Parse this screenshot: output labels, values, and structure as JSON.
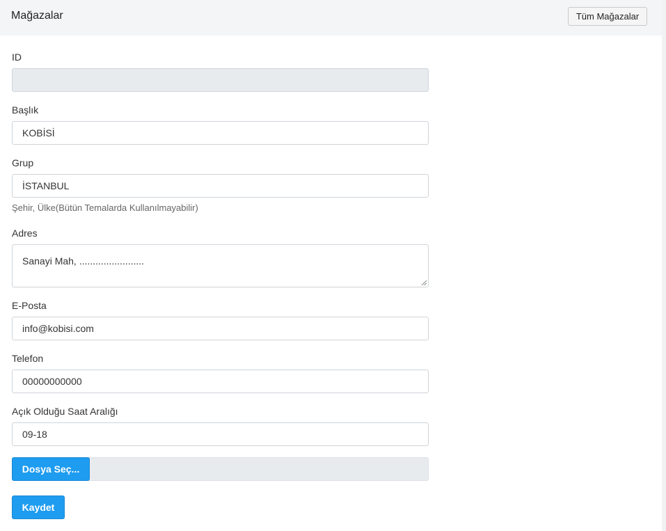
{
  "header": {
    "title": "Mağazalar",
    "all_stores_button": "Tüm Mağazalar"
  },
  "form": {
    "id": {
      "label": "ID",
      "value": ""
    },
    "title": {
      "label": "Başlık",
      "value": "KOBİSİ"
    },
    "group": {
      "label": "Grup",
      "value": "İSTANBUL",
      "help": "Şehir, Ülke(Bütün Temalarda Kullanılmayabilir)"
    },
    "address": {
      "label": "Adres",
      "value": "Sanayi Mah, ........................"
    },
    "email": {
      "label": "E-Posta",
      "value": "info@kobisi.com"
    },
    "phone": {
      "label": "Telefon",
      "value": "00000000000"
    },
    "hours": {
      "label": "Açık Olduğu Saat Aralığı",
      "value": "09-18"
    },
    "file": {
      "button_label": "Dosya Seç..."
    },
    "save_label": "Kaydet"
  },
  "colors": {
    "primary": "#1e9cf0",
    "header_bg": "#f4f5f7",
    "readonly_bg": "#e8ebee"
  }
}
